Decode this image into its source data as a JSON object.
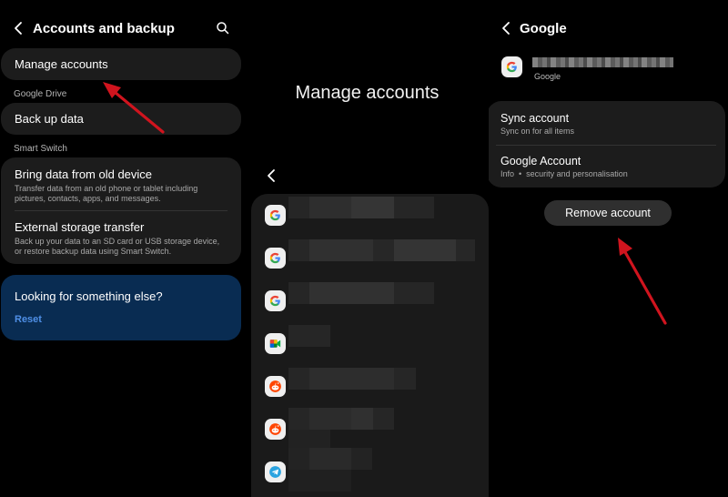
{
  "panel1": {
    "title": "Accounts and backup",
    "manage_accounts": "Manage accounts",
    "google_drive_label": "Google Drive",
    "back_up_data": "Back up data",
    "smart_switch_label": "Smart Switch",
    "bring_data": {
      "title": "Bring data from old device",
      "subtitle": "Transfer data from an old phone or tablet including pictures, contacts, apps, and messages."
    },
    "external_storage": {
      "title": "External storage transfer",
      "subtitle": "Back up your data to an SD card or USB storage device, or restore backup data using Smart Switch."
    },
    "promo": {
      "title": "Looking for something else?",
      "link": "Reset"
    },
    "icons": {
      "back": "back-arrow-icon",
      "search": "search-icon"
    }
  },
  "panel2": {
    "title": "Manage accounts",
    "accounts": [
      {
        "app": "Google",
        "icon": "google-icon"
      },
      {
        "app": "Google",
        "icon": "google-icon"
      },
      {
        "app": "Google",
        "icon": "google-icon"
      },
      {
        "app": "Google Meet",
        "icon": "meet-icon"
      },
      {
        "app": "Reddit",
        "icon": "reddit-icon"
      },
      {
        "app": "Reddit",
        "icon": "reddit-icon"
      },
      {
        "app": "Telegram",
        "icon": "telegram-icon"
      }
    ]
  },
  "panel3": {
    "title": "Google",
    "provider": "Google",
    "sync_account": {
      "title": "Sync account",
      "subtitle": "Sync on for all items"
    },
    "google_account": {
      "title": "Google Account",
      "subtitle": "Info  •  security and personalisation"
    },
    "remove_account": "Remove account"
  },
  "colors": {
    "background": "#000000",
    "card": "#1c1c1c",
    "promo": "#092c52",
    "link": "#4f8fe6",
    "annotation_arrow": "#d0141e"
  }
}
